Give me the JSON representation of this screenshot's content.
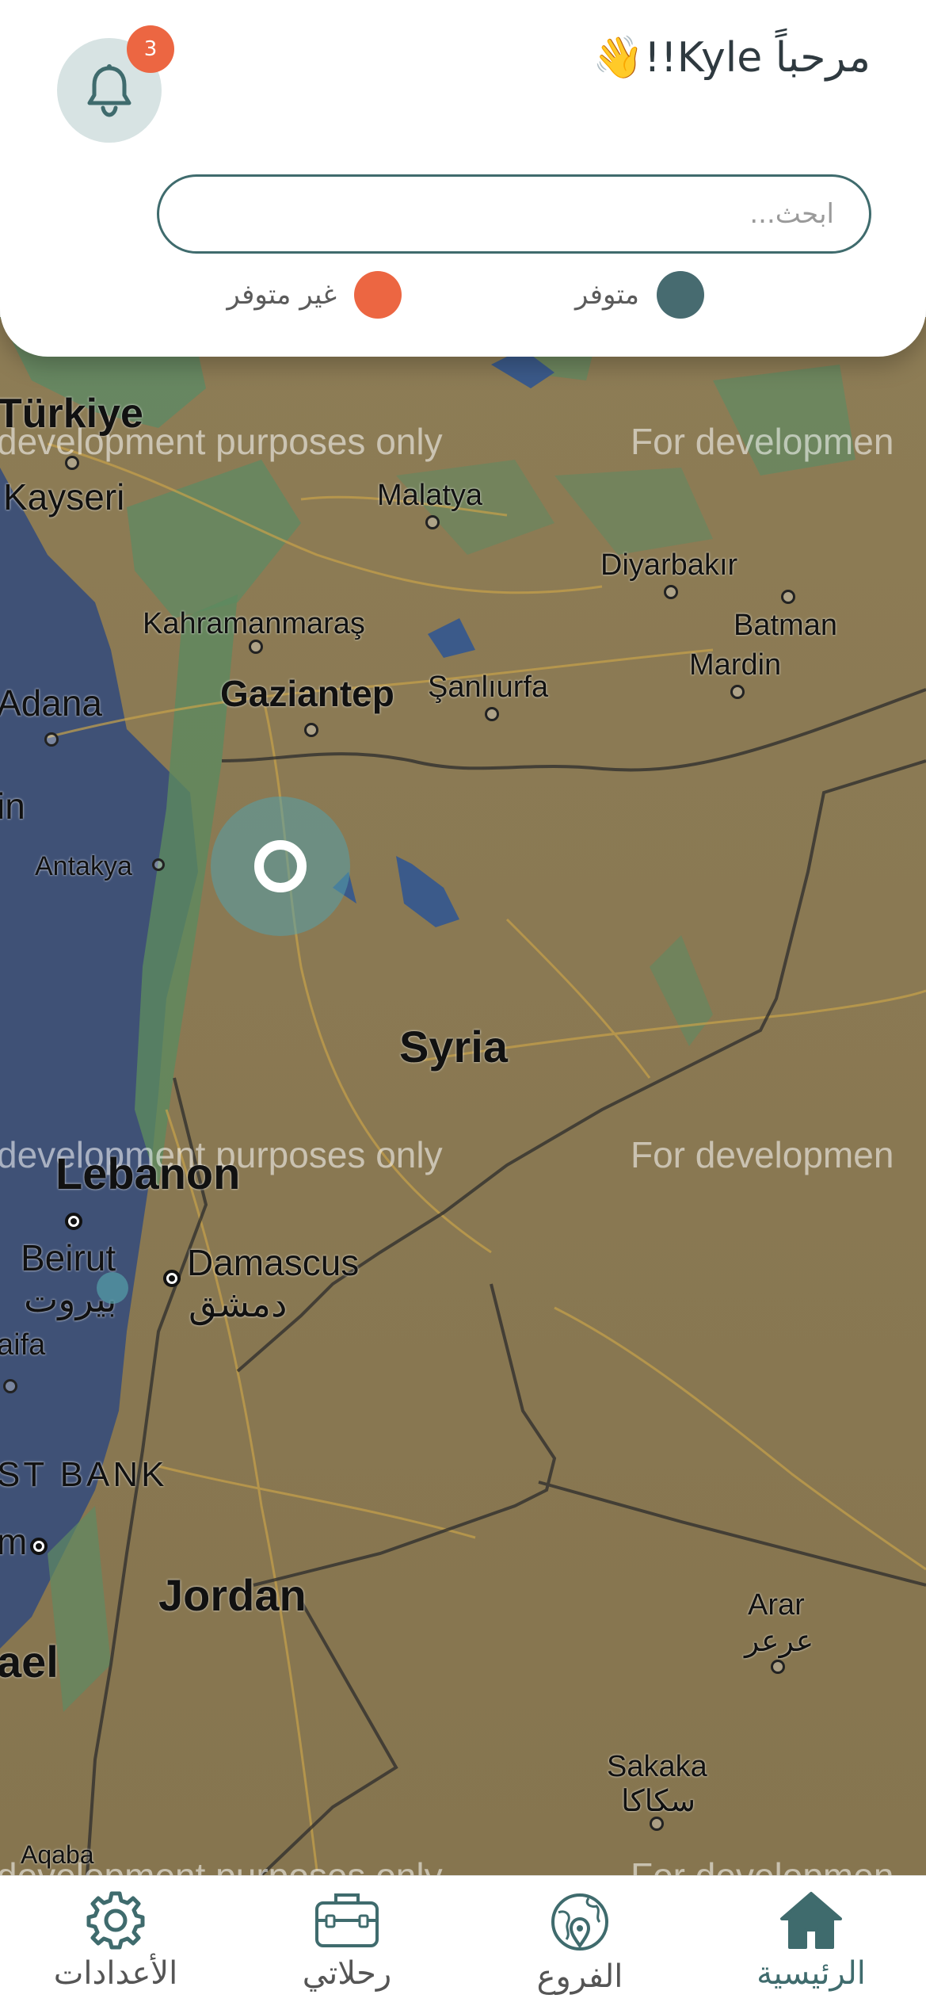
{
  "header": {
    "greeting": "مرحباً Kyle!!👋",
    "notification_count": "3",
    "search_placeholder": "ابحث..."
  },
  "legend": {
    "available": {
      "label": "متوفر",
      "color": "#476b70"
    },
    "unavailable": {
      "label": "غير متوفر",
      "color": "#ec6642"
    }
  },
  "map": {
    "watermark": "For development purposes only",
    "watermark_left": "development purposes only",
    "watermark_right": "For developmen",
    "countries": [
      "Türkiye",
      "Syria",
      "Lebanon",
      "Jordan"
    ],
    "regions": [
      "ST BANK"
    ],
    "cities": {
      "kayseri": "Kayseri",
      "malatya": "Malatya",
      "diyarbakir": "Diyarbakır",
      "batman": "Batman",
      "kahramanmaras": "Kahramanmaraş",
      "mardin": "Mardin",
      "adana": "Adana",
      "gaziantep": "Gaziantep",
      "sanliurfa": "Şanlıurfa",
      "antakya": "Antakya",
      "beirut": "Beirut",
      "beirut_ar": "بيروت",
      "damascus": "Damascus",
      "damascus_ar": "دمشق",
      "haifa": "aifa",
      "amman_partial": "m",
      "israel_partial": "ael",
      "arar": "Arar",
      "arar_ar": "عرعر",
      "sakaka": "Sakaka",
      "sakaka_ar": "سكاكا",
      "aqaba": "Aqaba",
      "lebanon_partial_in": "in"
    }
  },
  "nav": {
    "home": "الرئيسية",
    "branches": "الفروع",
    "trips": "رحلاتي",
    "settings": "الأعدادات"
  }
}
